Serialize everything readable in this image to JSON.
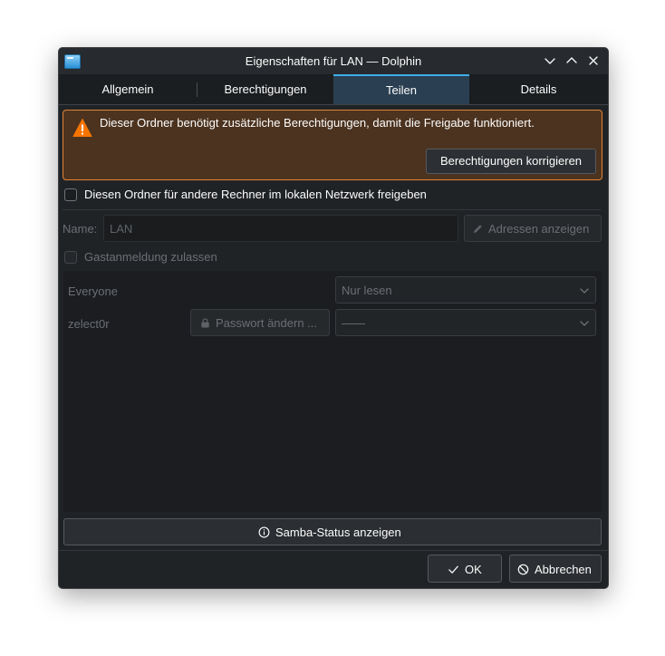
{
  "window": {
    "title": "Eigenschaften für LAN — Dolphin"
  },
  "tabs": [
    {
      "label": "Allgemein",
      "active": false
    },
    {
      "label": "Berechtigungen",
      "active": false
    },
    {
      "label": "Teilen",
      "active": true
    },
    {
      "label": "Details",
      "active": false
    }
  ],
  "warning": {
    "icon": "warning-triangle-icon",
    "text": "Dieser Ordner benötigt zusätzliche Berechtigungen, damit die Freigabe funktioniert.",
    "fix_button": "Berechtigungen korrigieren"
  },
  "share": {
    "checkbox_label": "Diesen Ordner für andere Rechner im lokalen Netzwerk freigeben",
    "checked": false
  },
  "name_row": {
    "label": "Name:",
    "value": "LAN",
    "address_button": "Adressen anzeigen"
  },
  "guest": {
    "label": "Gastanmeldung zulassen",
    "checked": false
  },
  "users": [
    {
      "name": "Everyone",
      "permission": "Nur lesen"
    },
    {
      "name": "zelect0r",
      "password_button": "Passwort ändern ...",
      "permission": "——"
    }
  ],
  "samba_button": "Samba-Status anzeigen",
  "footer": {
    "ok": "OK",
    "cancel": "Abbrechen"
  },
  "colors": {
    "accent": "#3daee9",
    "warning_border": "#e28434",
    "warning_bg": "#4c331f",
    "window_bg": "#202326"
  }
}
